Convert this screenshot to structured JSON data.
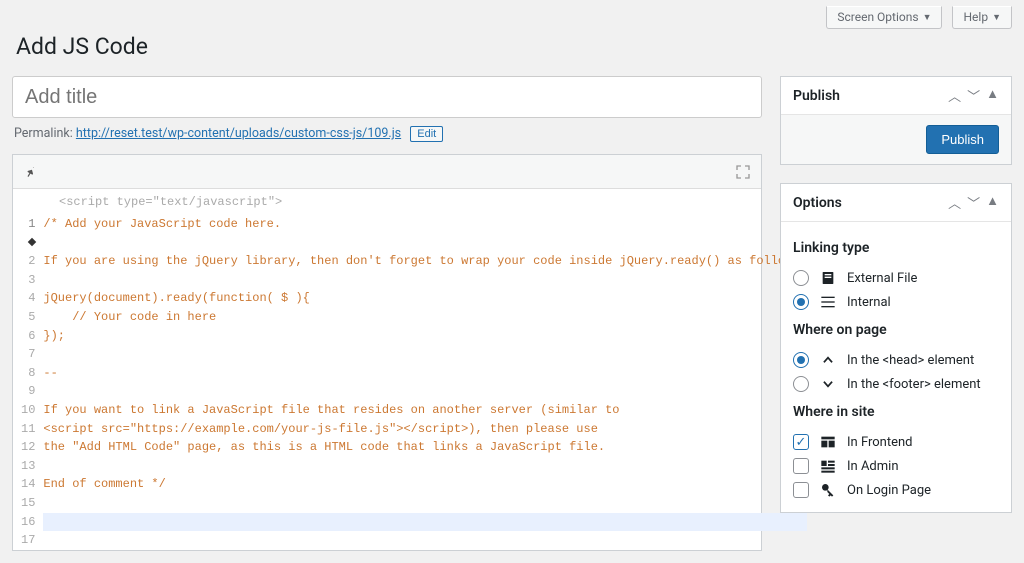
{
  "topbar": {
    "screen_options": "Screen Options",
    "help": "Help"
  },
  "page_title": "Add JS Code",
  "title_placeholder": "Add title",
  "permalink": {
    "label": "Permalink:",
    "url": "http://reset.test/wp-content/uploads/custom-css-js/109.js",
    "edit": "Edit"
  },
  "editor": {
    "header_tag": "<script type=\"text/javascript\">",
    "lines": [
      "/* Add your JavaScript code here.",
      "",
      "If you are using the jQuery library, then don't forget to wrap your code inside jQuery.ready() as follows:",
      "",
      "jQuery(document).ready(function( $ ){",
      "    // Your code in here",
      "});",
      "",
      "--",
      "",
      "If you want to link a JavaScript file that resides on another server (similar to",
      "<script src=\"https://example.com/your-js-file.js\"></script>), then please use",
      "the \"Add HTML Code\" page, as this is a HTML code that links a JavaScript file.",
      "",
      "End of comment */",
      "",
      ""
    ]
  },
  "publish_panel": {
    "title": "Publish",
    "button": "Publish"
  },
  "options_panel": {
    "title": "Options",
    "linking": {
      "title": "Linking type",
      "external": "External File",
      "internal": "Internal"
    },
    "where_page": {
      "title": "Where on page",
      "head": "In the <head> element",
      "footer": "In the <footer> element"
    },
    "where_site": {
      "title": "Where in site",
      "frontend": "In Frontend",
      "admin": "In Admin",
      "login": "On Login Page"
    }
  }
}
